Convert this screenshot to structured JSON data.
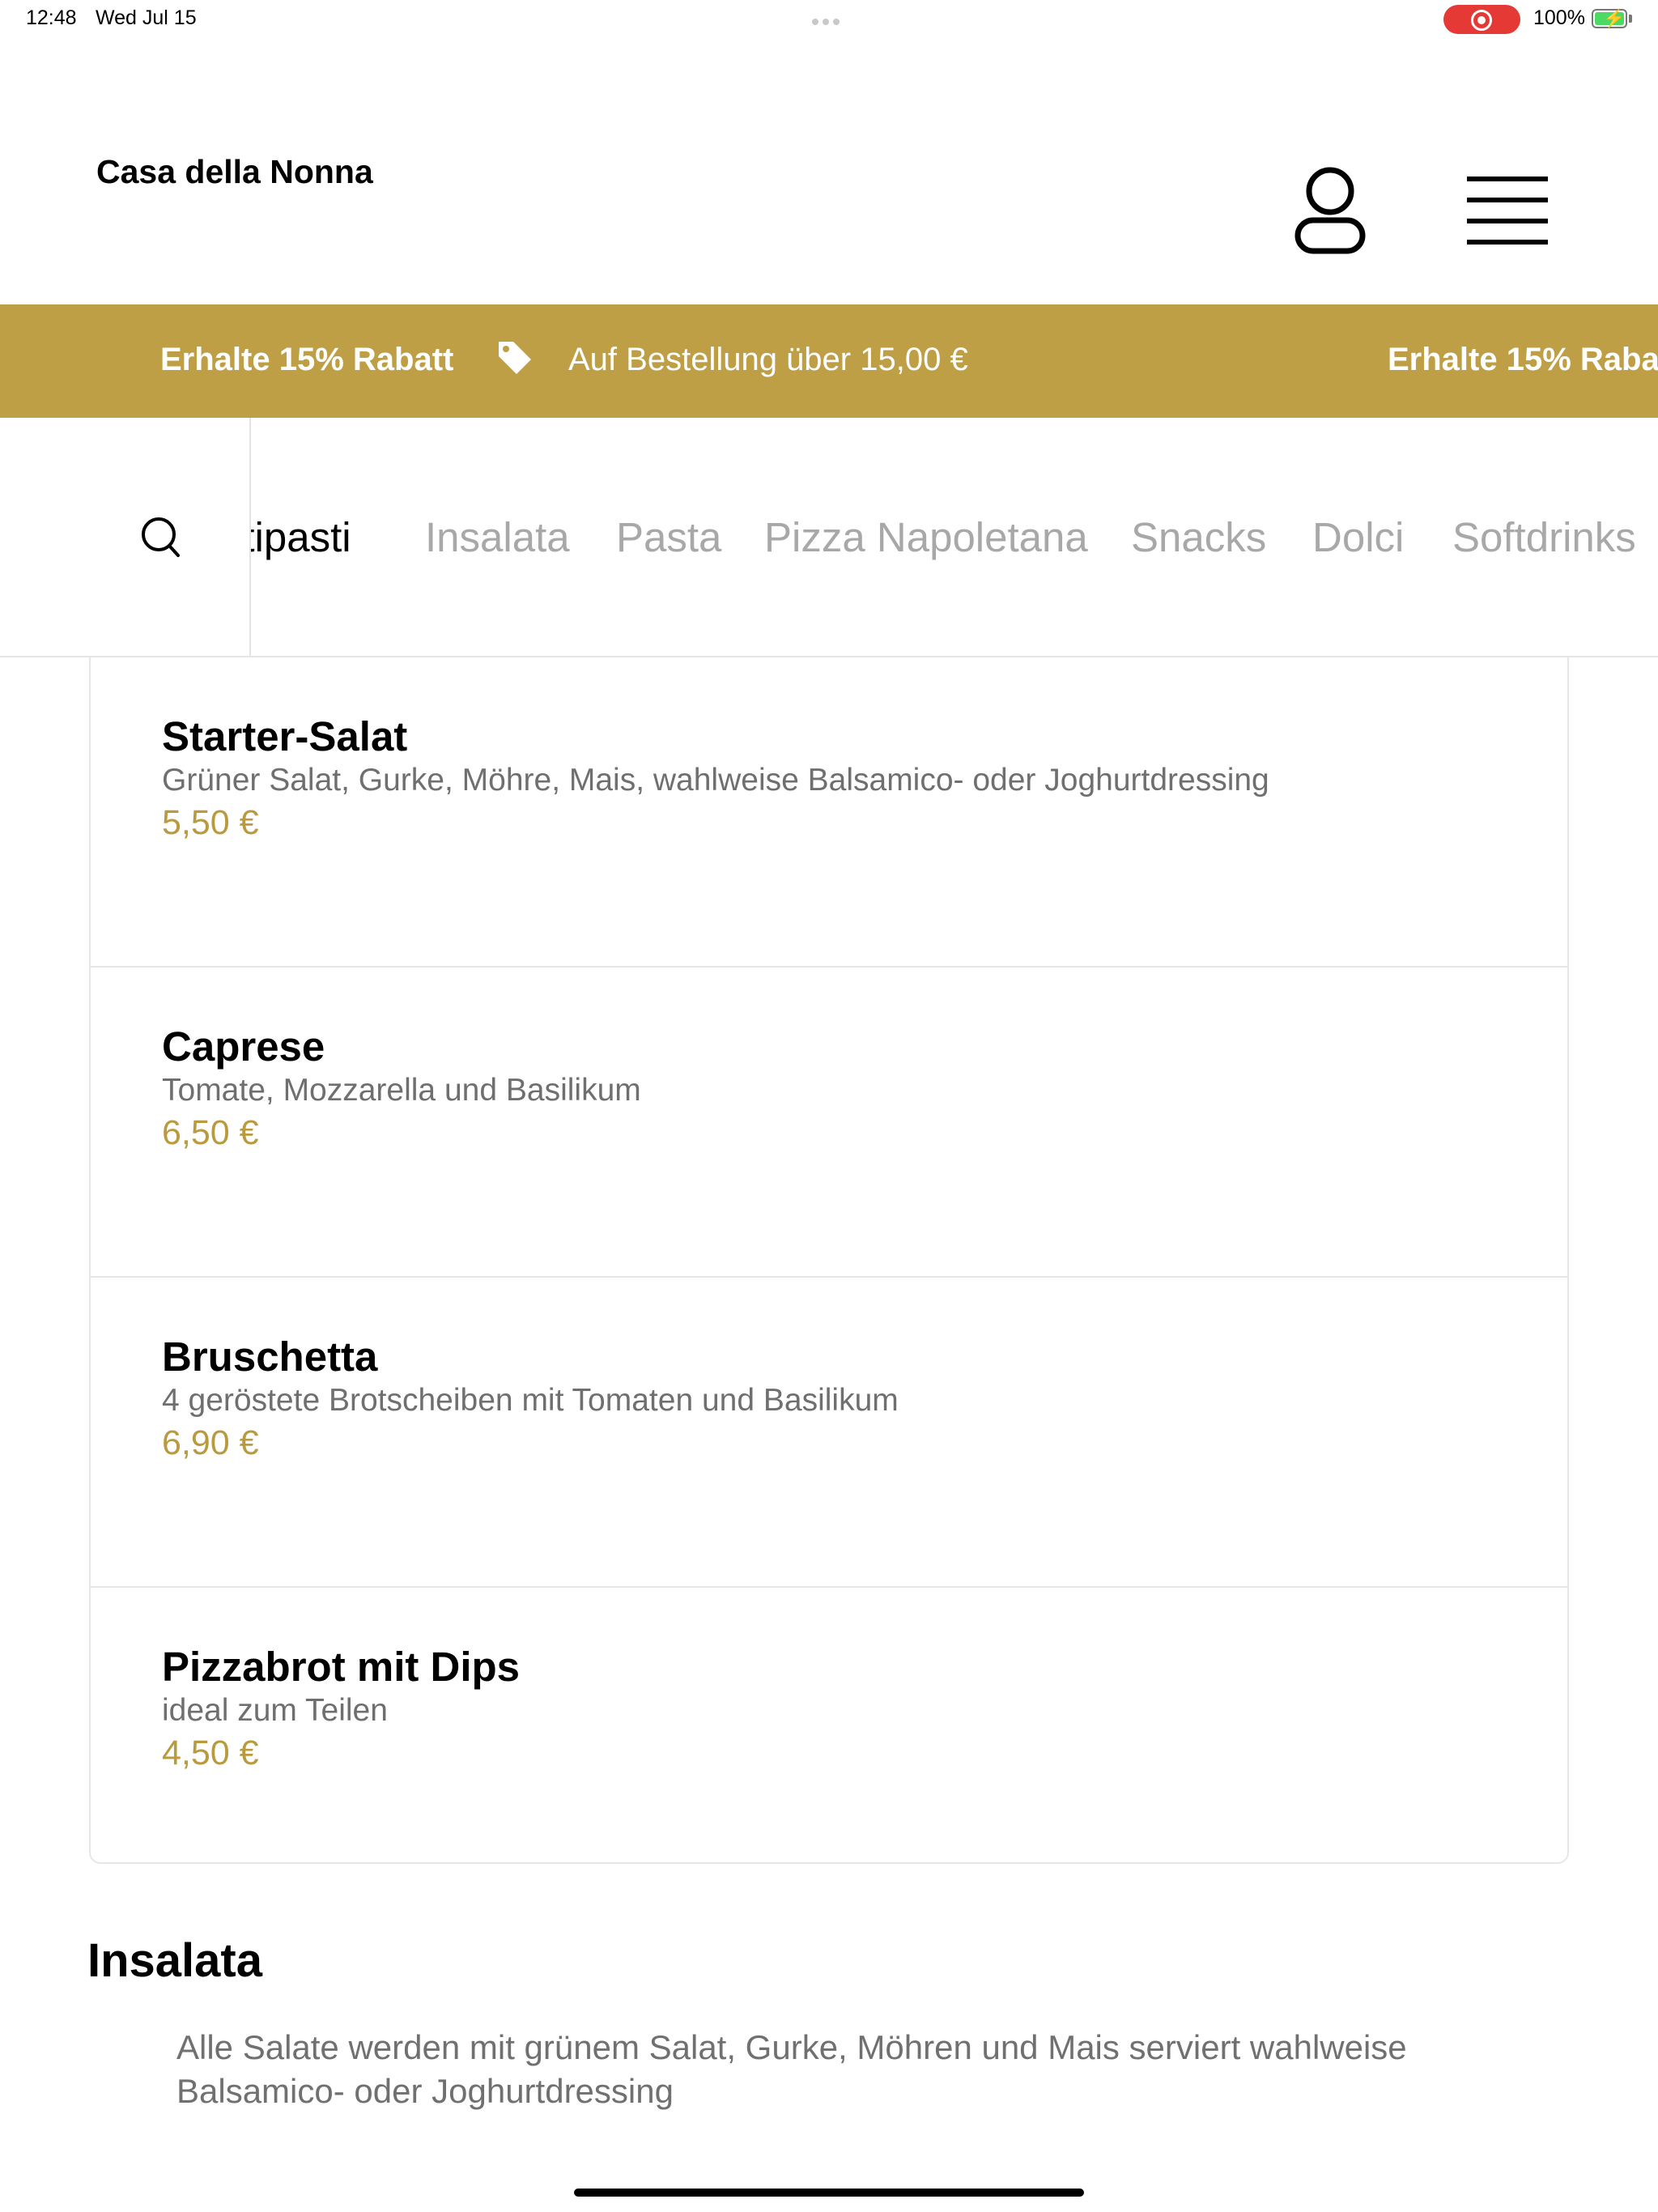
{
  "status_bar": {
    "time": "12:48",
    "date": "Wed Jul 15",
    "battery": "100%"
  },
  "header": {
    "brand": "Casa della Nonna"
  },
  "promo": {
    "headline": "Erhalte 15% Rabatt",
    "subtext": "Auf Bestellung über 15,00 €",
    "headline_repeat": "Erhalte 15% Raba",
    "accent_color": "#bf9f45"
  },
  "categories": [
    {
      "label": "ntipasti",
      "active": true
    },
    {
      "label": "Insalata",
      "active": false
    },
    {
      "label": "Pasta",
      "active": false
    },
    {
      "label": "Pizza Napoletana",
      "active": false
    },
    {
      "label": "Snacks",
      "active": false
    },
    {
      "label": "Dolci",
      "active": false
    },
    {
      "label": "Softdrinks",
      "active": false
    }
  ],
  "items": [
    {
      "name": "Starter-Salat",
      "description": "Grüner Salat, Gurke, Möhre, Mais, wahlweise Balsamico- oder Joghurtdressing",
      "price": "5,50 €"
    },
    {
      "name": "Caprese",
      "description": "Tomate, Mozzarella und Basilikum",
      "price": "6,50 €"
    },
    {
      "name": "Bruschetta",
      "description": "4 geröstete Brotscheiben mit Tomaten und Basilikum",
      "price": "6,90 €"
    },
    {
      "name": "Pizzabrot mit Dips",
      "description": "ideal zum Teilen",
      "price": "4,50 €"
    }
  ],
  "section": {
    "title": "Insalata",
    "description": "Alle Salate werden mit grünem Salat, Gurke, Möhren und Mais serviert wahlweise Balsamico- oder Joghurtdressing"
  },
  "icons": {
    "user": "user-icon",
    "menu": "hamburger-menu-icon",
    "tag": "price-tag-icon",
    "search": "search-icon"
  },
  "colors": {
    "price": "#b99a3e",
    "inactive_category": "#a8a8a8"
  }
}
